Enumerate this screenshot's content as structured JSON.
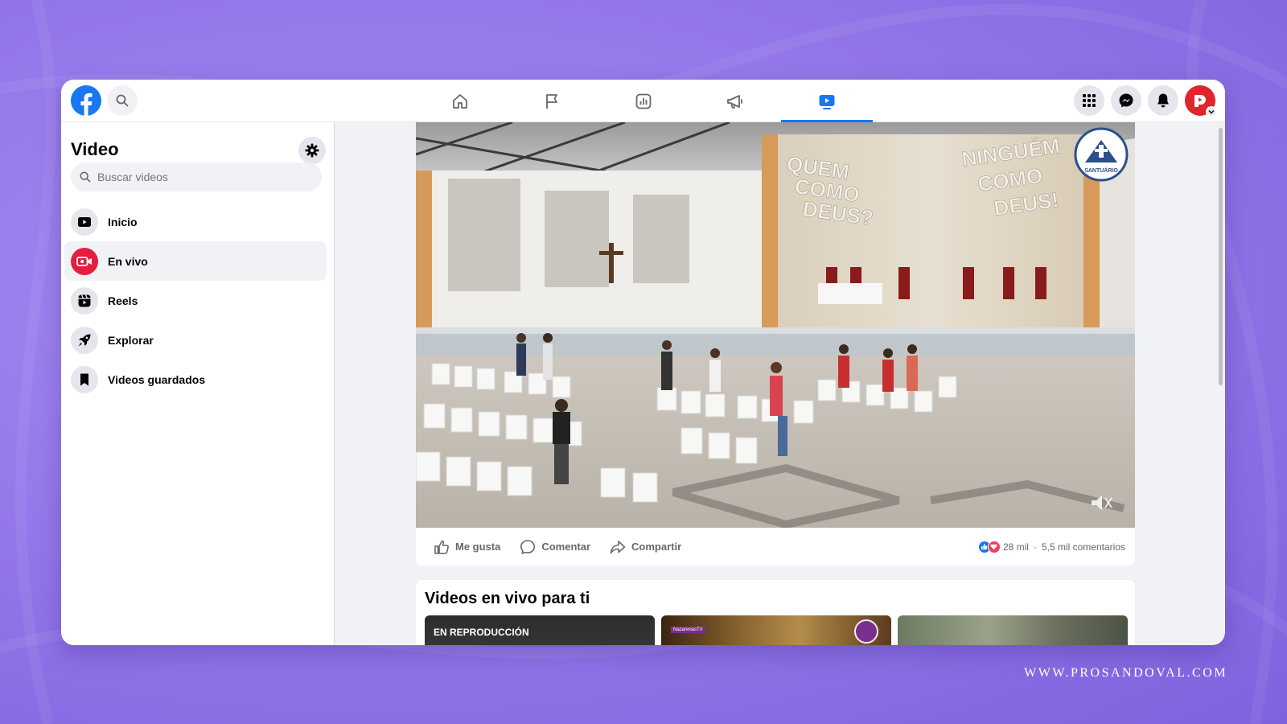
{
  "topbar": {
    "nav": [
      {
        "name": "home-icon",
        "active": false
      },
      {
        "name": "pages-flag-icon",
        "active": false
      },
      {
        "name": "insights-icon",
        "active": false
      },
      {
        "name": "ads-megaphone-icon",
        "active": false
      },
      {
        "name": "video-icon",
        "active": true
      }
    ],
    "right_icons": [
      "menu-grid-icon",
      "messenger-icon",
      "notifications-bell-icon",
      "profile-avatar"
    ]
  },
  "sidebar": {
    "title": "Video",
    "search_placeholder": "Buscar videos",
    "items": [
      {
        "label": "Inicio",
        "icon": "video-play-icon",
        "active": false
      },
      {
        "label": "En vivo",
        "icon": "live-camera-icon",
        "active": true
      },
      {
        "label": "Reels",
        "icon": "reels-icon",
        "active": false
      },
      {
        "label": "Explorar",
        "icon": "rocket-icon",
        "active": false
      },
      {
        "label": "Videos guardados",
        "icon": "bookmark-icon",
        "active": false
      }
    ]
  },
  "player": {
    "wall_left": "QUEM COMO DEUS?",
    "wall_right": "NINGUÉM COMO DEUS!",
    "logo_text": "SANTUÁRIO"
  },
  "actions": {
    "like": "Me gusta",
    "comment": "Comentar",
    "share": "Compartir",
    "reaction_count": "28 mil",
    "separator": "·",
    "comment_count": "5,5 mil comentarios"
  },
  "live_section": {
    "title": "Videos en vivo para ti",
    "thumbs": [
      {
        "badge": "EN REPRODUCCIÓN"
      },
      {
        "badge": "NazarenasTV"
      },
      {
        "badge": ""
      }
    ]
  },
  "watermark": "WWW.PROSANDOVAL.COM",
  "colors": {
    "accent": "#1877f2",
    "live": "#e41e3f",
    "background": "#9a80ec"
  }
}
